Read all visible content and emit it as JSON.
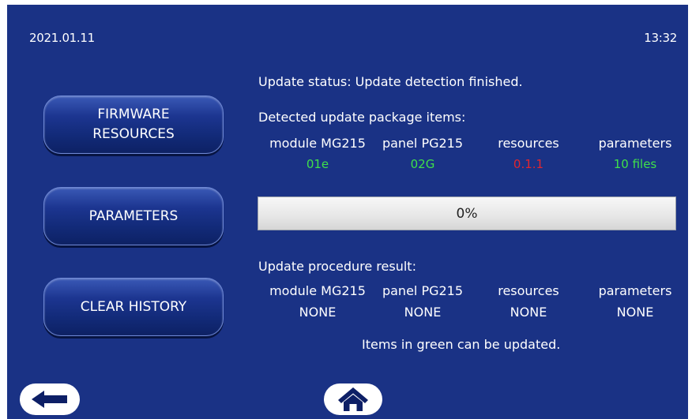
{
  "header": {
    "date": "2021.01.11",
    "time": "13:32"
  },
  "side_buttons": {
    "firmware_line1": "FIRMWARE",
    "firmware_line2": "RESOURCES",
    "parameters": "PARAMETERS",
    "clear_history": "CLEAR HISTORY"
  },
  "status": {
    "text": "Update status: Update detection finished."
  },
  "detected": {
    "title": "Detected update package items:",
    "items": [
      {
        "label": "module MG215",
        "value": "01e",
        "color": "#3fe04a"
      },
      {
        "label": "panel PG215",
        "value": "02G",
        "color": "#3fe04a"
      },
      {
        "label": "resources",
        "value": "0.1.1",
        "color": "#e0262f"
      },
      {
        "label": "parameters",
        "value": "10 files",
        "color": "#3fe04a"
      }
    ]
  },
  "progress": {
    "percent": 0,
    "label": "0%"
  },
  "result": {
    "title": "Update procedure result:",
    "items": [
      {
        "label": "module MG215",
        "value": "NONE"
      },
      {
        "label": "panel PG215",
        "value": "NONE"
      },
      {
        "label": "resources",
        "value": "NONE"
      },
      {
        "label": "parameters",
        "value": "NONE"
      }
    ]
  },
  "hint": "Items in green can be updated.",
  "nav": {
    "back_icon": "arrow-left-icon",
    "home_icon": "home-icon"
  },
  "colors": {
    "background": "#1a3285",
    "ok": "#3fe04a",
    "error": "#e0262f"
  }
}
